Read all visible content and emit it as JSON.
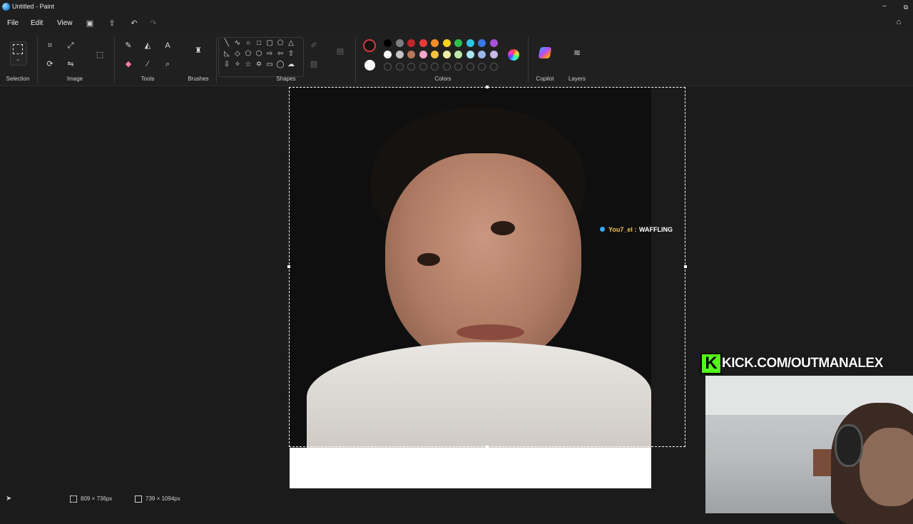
{
  "window": {
    "title": "Untitled - Paint",
    "minimize": "–",
    "maximize": "⧉"
  },
  "menu": {
    "file": "File",
    "edit": "Edit",
    "view": "View"
  },
  "ribbon": {
    "groups": {
      "selection": "Selection",
      "image": "Image",
      "tools": "Tools",
      "brushes": "Brushes",
      "shapes": "Shapes",
      "colors": "Colors",
      "copilot": "Copilot",
      "layers": "Layers"
    },
    "colors": {
      "current": "#121212",
      "secondary": "#ffffff",
      "palette_row1": [
        "#000000",
        "#7f7f7f",
        "#c0272d",
        "#e63b3b",
        "#f28c28",
        "#f7d21a",
        "#2fbf4f",
        "#2ec4e6",
        "#3b78e7",
        "#a552d8"
      ],
      "palette_row2": [
        "#ffffff",
        "#c3c3c3",
        "#b9775a",
        "#f4a7c8",
        "#f5c242",
        "#f2eea0",
        "#bfe6a8",
        "#a8e6f0",
        "#9bb7e8",
        "#c9b8ea"
      ]
    }
  },
  "overlay": {
    "chat_user": "You7_el :",
    "chat_message": "WAFFLING",
    "kick_logo": "K",
    "kick_url": "KICK.COM/OUTMANALEX"
  },
  "status": {
    "selection_size": "809 × 736px",
    "canvas_size": "739 × 1094px"
  }
}
